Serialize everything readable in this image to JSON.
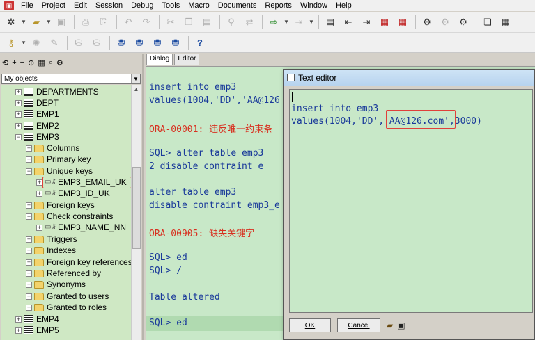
{
  "menubar": {
    "items": [
      "File",
      "Project",
      "Edit",
      "Session",
      "Debug",
      "Tools",
      "Macro",
      "Documents",
      "Reports",
      "Window",
      "Help"
    ]
  },
  "left_pane": {
    "toolbar_glyphs": [
      "⟲",
      "+",
      "−",
      "⊕",
      "▦",
      "⌕",
      "⚙"
    ],
    "selector_value": "My objects",
    "tree": [
      {
        "label": "DEPARTMENTS",
        "icon": "table-icon",
        "depth": 1
      },
      {
        "label": "DEPT",
        "icon": "table-icon",
        "depth": 1
      },
      {
        "label": "EMP1",
        "icon": "table-icon",
        "depth": 1
      },
      {
        "label": "EMP2",
        "icon": "table-icon",
        "depth": 1
      },
      {
        "label": "EMP3",
        "icon": "table-icon",
        "depth": 1,
        "expanded": true
      },
      {
        "label": "Columns",
        "icon": "folder-icon",
        "depth": 2
      },
      {
        "label": "Primary key",
        "icon": "folder-icon",
        "depth": 2
      },
      {
        "label": "Unique keys",
        "icon": "folder-icon",
        "depth": 2,
        "expanded": true
      },
      {
        "label": "EMP3_EMAIL_UK",
        "icon": "key-icon",
        "depth": 3,
        "highlighted": true
      },
      {
        "label": "EMP3_ID_UK",
        "icon": "key-icon",
        "depth": 3
      },
      {
        "label": "Foreign keys",
        "icon": "folder-icon",
        "depth": 2
      },
      {
        "label": "Check constraints",
        "icon": "folder-icon",
        "depth": 2,
        "expanded": true
      },
      {
        "label": "EMP3_NAME_NN",
        "icon": "key-icon",
        "depth": 3
      },
      {
        "label": "Triggers",
        "icon": "folder-icon",
        "depth": 2
      },
      {
        "label": "Indexes",
        "icon": "folder-icon",
        "depth": 2
      },
      {
        "label": "Foreign key references",
        "icon": "folder-icon",
        "depth": 2
      },
      {
        "label": "Referenced by",
        "icon": "folder-icon",
        "depth": 2
      },
      {
        "label": "Synonyms",
        "icon": "folder-icon",
        "depth": 2
      },
      {
        "label": "Granted to users",
        "icon": "folder-icon",
        "depth": 2
      },
      {
        "label": "Granted to roles",
        "icon": "folder-icon",
        "depth": 2
      },
      {
        "label": "EMP4",
        "icon": "table-icon",
        "depth": 1
      },
      {
        "label": "EMP5",
        "icon": "table-icon",
        "depth": 1
      }
    ]
  },
  "tabs": [
    {
      "label": "Dialog",
      "active": true
    },
    {
      "label": "Editor",
      "active": false
    }
  ],
  "sql_output": [
    {
      "text": "insert into emp3",
      "error": false
    },
    {
      "text": "values(1004,'DD','AA@126",
      "error": false
    },
    {
      "text": "",
      "error": false
    },
    {
      "text": "ORA-00001: 违反唯一约束条",
      "error": true
    },
    {
      "text": "",
      "error": false
    },
    {
      "text": "SQL> alter table emp3",
      "error": false
    },
    {
      "text": "  2  disable contraint e",
      "error": false
    },
    {
      "text": "",
      "error": false
    },
    {
      "text": "alter table emp3",
      "error": false
    },
    {
      "text": "disable contraint emp3_e",
      "error": false
    },
    {
      "text": "",
      "error": false
    },
    {
      "text": "ORA-00905: 缺失关键字",
      "error": true
    },
    {
      "text": "",
      "error": false
    },
    {
      "text": "SQL> ed",
      "error": false
    },
    {
      "text": "SQL> /",
      "error": false
    },
    {
      "text": "",
      "error": false
    },
    {
      "text": "Table altered",
      "error": false
    },
    {
      "text": "",
      "error": false
    },
    {
      "text": "SQL> ed",
      "error": false
    }
  ],
  "text_editor": {
    "title": "Text editor",
    "line1": "insert into emp3",
    "line2_prefix": "values(1004,'DD',",
    "line2_highlight": "'AA@126.com'",
    "line2_suffix": ",3000)",
    "ok_label": "OK",
    "cancel_label": "Cancel"
  },
  "colors": {
    "editor_bg": "#c8e8c8",
    "sql_text": "#1a3a9a",
    "error_text": "#d83020",
    "highlight_border": "#e0403a"
  }
}
